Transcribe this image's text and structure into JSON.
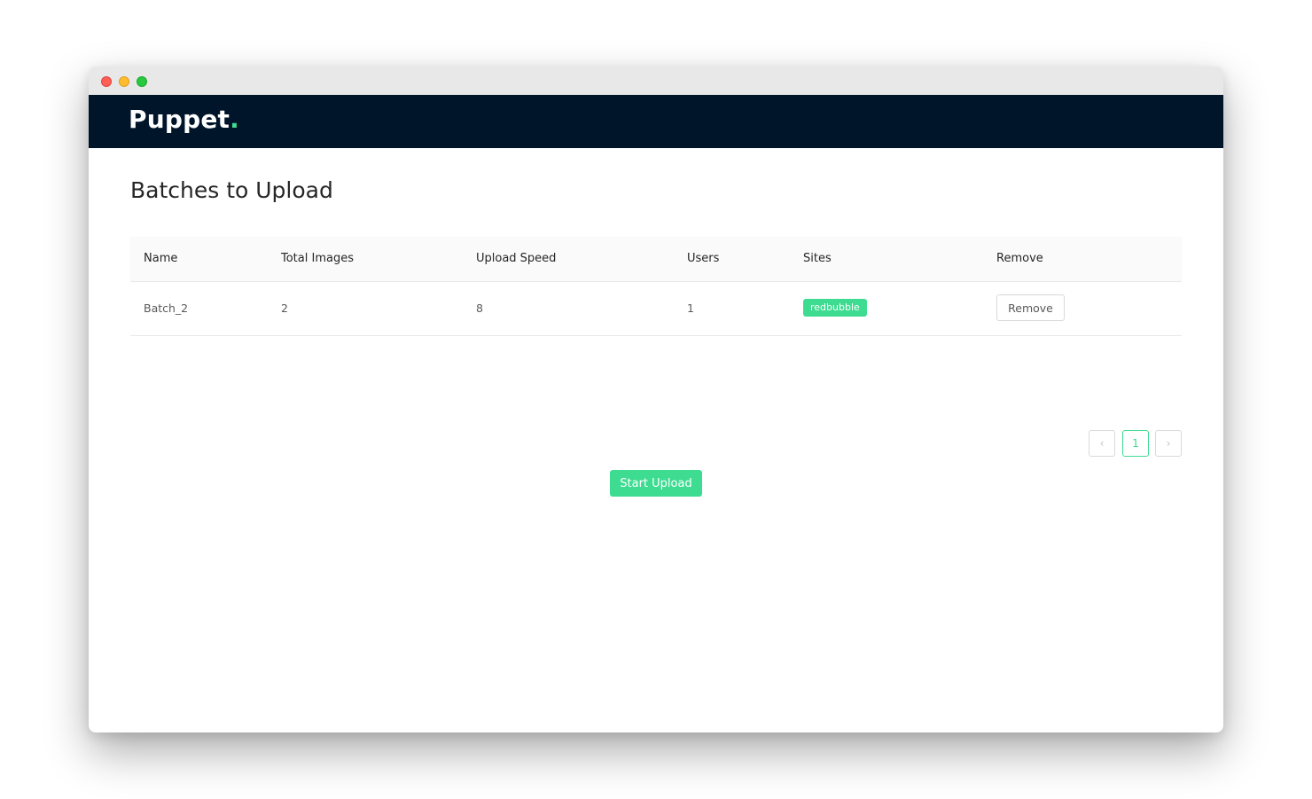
{
  "window": {
    "controls": [
      "close",
      "minimize",
      "maximize"
    ]
  },
  "header": {
    "logo_text": "Puppet",
    "logo_dot": ".",
    "accent_color": "#3ddc91",
    "background_color": "#00142a"
  },
  "main": {
    "title": "Batches to Upload",
    "table": {
      "columns": [
        "Name",
        "Total Images",
        "Upload Speed",
        "Users",
        "Sites",
        "Remove"
      ],
      "rows": [
        {
          "name": "Batch_2",
          "total_images": "2",
          "upload_speed": "8",
          "users": "1",
          "site_tag": "redbubble",
          "remove_label": "Remove"
        }
      ]
    },
    "pagination": {
      "prev_icon": "‹",
      "current_page": "1",
      "next_icon": "›"
    },
    "start_upload_label": "Start Upload"
  }
}
